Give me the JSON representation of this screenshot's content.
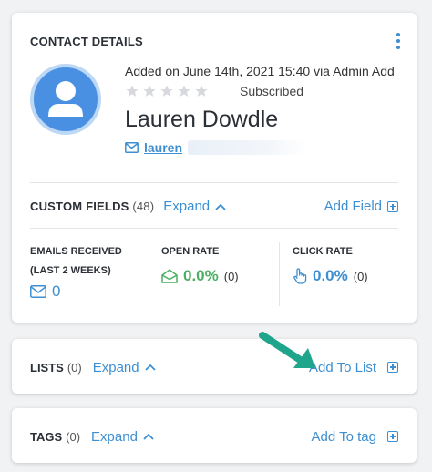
{
  "contact_details": {
    "title": "CONTACT DETAILS",
    "added_text": "Added on June 14th, 2021 15:40 via Admin Add",
    "status": "Subscribed",
    "name": "Lauren Dowdle",
    "email": "lauren",
    "rating": 0,
    "rating_max": 5
  },
  "custom_fields": {
    "title": "CUSTOM FIELDS",
    "count": "(48)",
    "expand_label": "Expand",
    "add_label": "Add Field"
  },
  "stats": {
    "emails_received_label_1": "EMAILS RECEIVED",
    "emails_received_label_2": "(LAST 2 WEEKS)",
    "emails_received_value": "0",
    "open_rate_label": "OPEN RATE",
    "open_rate_value": "0.0%",
    "open_rate_count": "(0)",
    "click_rate_label": "CLICK RATE",
    "click_rate_value": "0.0%",
    "click_rate_count": "(0)"
  },
  "lists": {
    "title": "LISTS",
    "count": "(0)",
    "expand_label": "Expand",
    "add_label": "Add To List"
  },
  "tags": {
    "title": "TAGS",
    "count": "(0)",
    "expand_label": "Expand",
    "add_label": "Add To tag"
  },
  "colors": {
    "accent": "#3d8fd1",
    "success": "#4caf63",
    "arrow": "#1fa58c"
  }
}
